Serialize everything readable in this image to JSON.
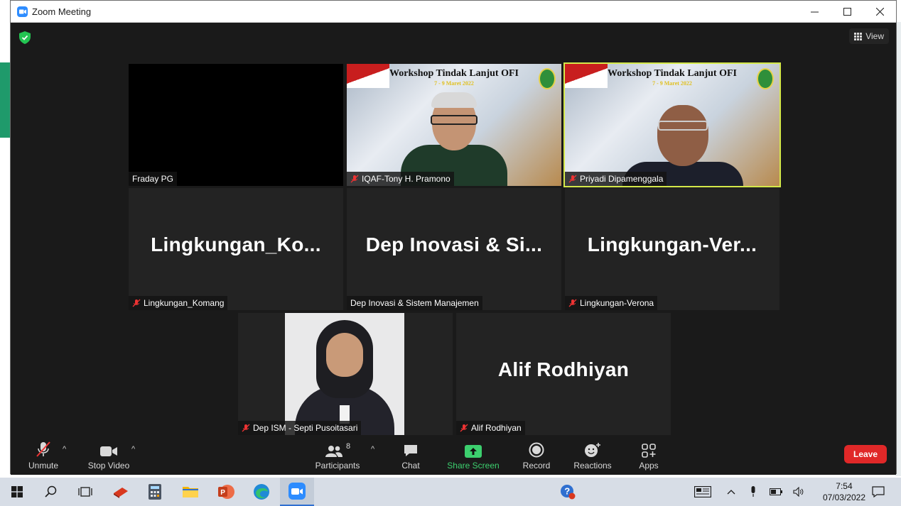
{
  "window": {
    "title": "Zoom Meeting"
  },
  "meeting": {
    "view_label": "View",
    "tiles": [
      {
        "name": "Fraday PG",
        "big": "",
        "muted": false
      },
      {
        "name": "IQAF-Tony H. Pramono",
        "big": "",
        "muted": true,
        "banner": "Workshop Tindak Lanjut OFI",
        "sub": "7 - 9 Maret 2022"
      },
      {
        "name": "Priyadi Dipamenggala",
        "big": "",
        "muted": true,
        "banner": "Workshop Tindak Lanjut OFI",
        "sub": "7 - 9 Maret 2022",
        "active": true
      },
      {
        "name": "Lingkungan_Komang",
        "big": "Lingkungan_Ko...",
        "muted": true
      },
      {
        "name": "Dep Inovasi & Sistem Manajemen",
        "big": "Dep Inovasi & Si...",
        "muted": false
      },
      {
        "name": "Lingkungan-Verona",
        "big": "Lingkungan-Ver...",
        "muted": true
      },
      {
        "name": "Dep ISM - Septi Pusoitasari",
        "big": "",
        "muted": true
      },
      {
        "name": "Alif Rodhiyan",
        "big": "Alif Rodhiyan",
        "muted": true
      }
    ],
    "active_border_color": "#d4e84a"
  },
  "toolbar": {
    "unmute": "Unmute",
    "stop_video": "Stop Video",
    "participants": "Participants",
    "participants_count": "8",
    "chat": "Chat",
    "share_screen": "Share Screen",
    "record": "Record",
    "reactions": "Reactions",
    "apps": "Apps",
    "leave": "Leave",
    "share_color": "#3ccf6e",
    "leave_color": "#e02828"
  },
  "taskbar": {
    "time": "7:54",
    "date": "07/03/2022"
  }
}
